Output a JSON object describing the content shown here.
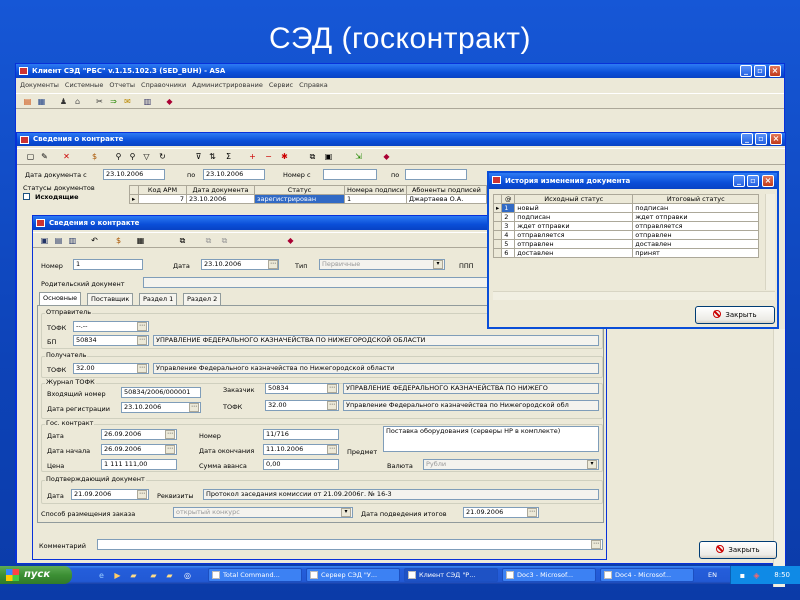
{
  "slide": {
    "title": "СЭД (госконтракт)"
  },
  "main_window": {
    "title": "Клиент СЭД \"РБС\" v.1.15.102.3 (SED_BUH) - ASA",
    "menu": [
      "Документы",
      "Системные",
      "Отчеты",
      "Справочники",
      "Администрирование",
      "Сервис",
      "Справка"
    ]
  },
  "contracts_window": {
    "title": "Сведения о контракте",
    "date_from_label": "Дата документа с",
    "date_from": "23.10.2006",
    "date_to_label": "по",
    "date_to": "23.10.2006",
    "number_from_label": "Номер с",
    "number_to_label": "по",
    "statuses_label": "Статусы документов",
    "outgoing_label": "Исходящие",
    "columns": [
      "Код АРМ",
      "Дата документа",
      "Статус",
      "Номера подписи",
      "Абоненты подписей"
    ],
    "row": {
      "arm": "7",
      "date": "23.10.2006",
      "status": "зарегистрирован",
      "num": "1",
      "abonent": "Джартаева О.А."
    },
    "close_label": "Закрыть"
  },
  "history_window": {
    "title": "История изменения документа",
    "columns": [
      "@",
      "Исходный статус",
      "Итоговый статус"
    ],
    "rows": [
      {
        "n": "1",
        "from": "новый",
        "to": "подписан"
      },
      {
        "n": "2",
        "from": "подписан",
        "to": "ждет отправки"
      },
      {
        "n": "3",
        "from": "ждет отправки",
        "to": "отправляется"
      },
      {
        "n": "4",
        "from": "отправляется",
        "to": "отправлен"
      },
      {
        "n": "5",
        "from": "отправлен",
        "to": "доставлен"
      },
      {
        "n": "6",
        "from": "доставлен",
        "to": "принят"
      }
    ],
    "close_label": "Закрыть"
  },
  "detail_window": {
    "title": "Сведения о контракте",
    "number_label": "Номер",
    "number": "1",
    "date_label": "Дата",
    "date": "23.10.2006",
    "type_label": "Тип",
    "type": "Первичные",
    "ppp_label": "ППП",
    "parent_label": "Родительский документ",
    "tabs": [
      "Основные",
      "Поставщик",
      "Раздел 1",
      "Раздел 2"
    ],
    "sender": {
      "group": "Отправитель",
      "tofk_label": "ТОФК",
      "tofk": "--.--",
      "bp_label": "БП",
      "bp": "50834",
      "bp_name": "УПРАВЛЕНИЕ ФЕДЕРАЛЬНОГО КАЗНАЧЕЙСТВА ПО НИЖЕГОРОДСКОЙ ОБЛАСТИ"
    },
    "recipient": {
      "group": "Получатель",
      "tofk_label": "ТОФК",
      "tofk": "32.00",
      "name": "Управление Федерального казначейства по Нижегородской области"
    },
    "journal": {
      "group": "Журнал ТОФК",
      "in_label": "Входящий номер",
      "in_number": "50834/2006/000001",
      "reg_label": "Дата регистрации",
      "reg_date": "23.10.2006",
      "customer_label": "Заказчик",
      "customer": "50834",
      "customer_name": "УПРАВЛЕНИЕ ФЕДЕРАЛЬНОГО КАЗНАЧЕЙСТВА ПО НИЖЕГО",
      "tofk_label": "ТОФК",
      "tofk": "32.00",
      "tofk_name": "Управление Федерального казначейства по Нижегородской обл"
    },
    "contract": {
      "group": "Гос. контракт",
      "date_label": "Дата",
      "date": "26.09.2006",
      "start_label": "Дата начала",
      "start": "26.09.2006",
      "price_label": "Цена",
      "price": "1 111 111,00",
      "number_label": "Номер",
      "number": "11/716",
      "end_label": "Дата окончания",
      "end": "11.10.2006",
      "advance_label": "Сумма аванса",
      "advance": "0,00",
      "subject_label": "Предмет",
      "subject": "Поставка оборудования (серверы HP в комплекте)",
      "currency_label": "Валюта",
      "currency": "Рубли"
    },
    "confirm": {
      "group": "Подтверждающий документ",
      "date_label": "Дата",
      "date": "21.09.2006",
      "req_label": "Реквизиты",
      "req": "Протокол заседания комиссии от 21.09.2006г. № 16-3"
    },
    "method_label": "Способ размещения заказа",
    "method": "открытый конкурс",
    "results_label": "Дата подведения итогов",
    "results_date": "21.09.2006",
    "comment_label": "Комментарий"
  },
  "taskbar": {
    "start": "пуск",
    "tasks": [
      "Total Command...",
      "Сервер СЭД \"У...",
      "Клиент СЭД \"Р...",
      "Doc3 - Microsof...",
      "Doc4 - Microsof..."
    ],
    "lang": "EN",
    "clock": "8:50"
  }
}
